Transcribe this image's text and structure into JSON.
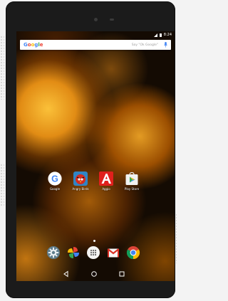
{
  "status_bar": {
    "time": "8:24"
  },
  "search": {
    "brand": "Google",
    "hint": "Say \"Ok Google\""
  },
  "apps": [
    {
      "label": "Google"
    },
    {
      "label": "Angry Birds"
    },
    {
      "label": "Aggio"
    },
    {
      "label": "Play Store"
    }
  ],
  "dock": [
    "settings-icon",
    "photos-icon",
    "app-drawer-icon",
    "gmail-icon",
    "chrome-icon"
  ],
  "nav": [
    "back-icon",
    "home-icon",
    "recents-icon"
  ]
}
